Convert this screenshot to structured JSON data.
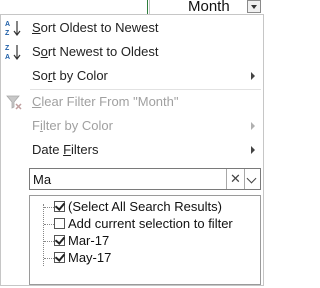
{
  "column_header": {
    "label": "Month"
  },
  "menu": {
    "sort_asc": {
      "label": "Sort Oldest to Newest",
      "icon": "sort-ascending-icon"
    },
    "sort_desc": {
      "label": "Sort Newest to Oldest",
      "icon": "sort-descending-icon"
    },
    "sort_color": {
      "label": "Sort by Color"
    },
    "clear_filter": {
      "label": "Clear Filter From \"Month\"",
      "icon": "clear-filter-icon"
    },
    "filter_color": {
      "label": "Filter by Color"
    },
    "date_filters": {
      "label": "Date Filters"
    }
  },
  "search": {
    "value": "Ma"
  },
  "checklist": [
    {
      "label": "(Select All Search Results)",
      "checked": true
    },
    {
      "label": "Add current selection to filter",
      "checked": false
    },
    {
      "label": "Mar-17",
      "checked": true
    },
    {
      "label": "May-17",
      "checked": true
    }
  ],
  "colors": {
    "grid_accent": "#2d7d3c",
    "disabled_text": "#a0a0a0"
  }
}
